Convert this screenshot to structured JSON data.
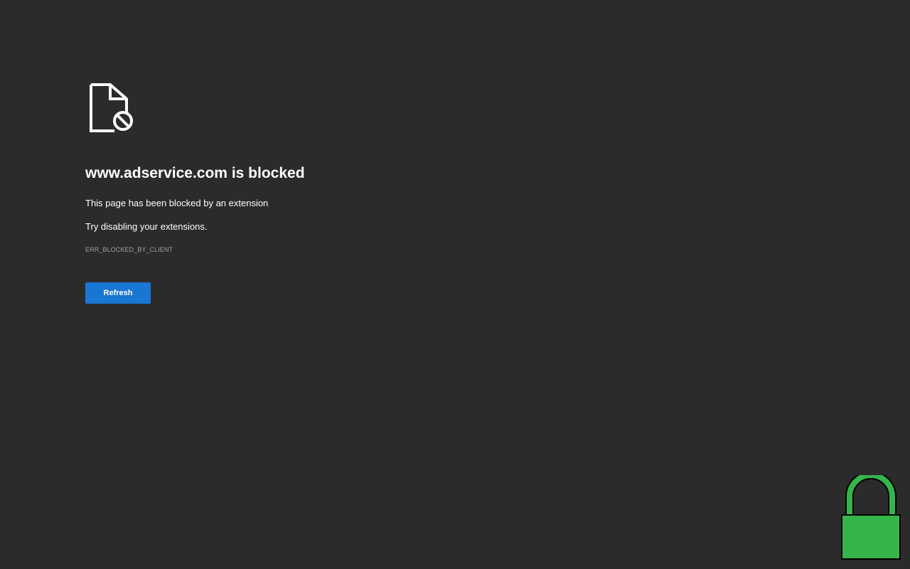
{
  "error": {
    "headline": "www.adservice.com is blocked",
    "message": "This page has been blocked by an extension",
    "suggestion": "Try disabling your extensions.",
    "code": "ERR_BLOCKED_BY_CLIENT",
    "icon": "blocked-file-icon"
  },
  "actions": {
    "refresh_label": "Refresh"
  },
  "overlay": {
    "icon": "lock-icon"
  },
  "colors": {
    "background": "#2b2b2b",
    "button": "#1976d2",
    "lock": "#35b44a"
  }
}
